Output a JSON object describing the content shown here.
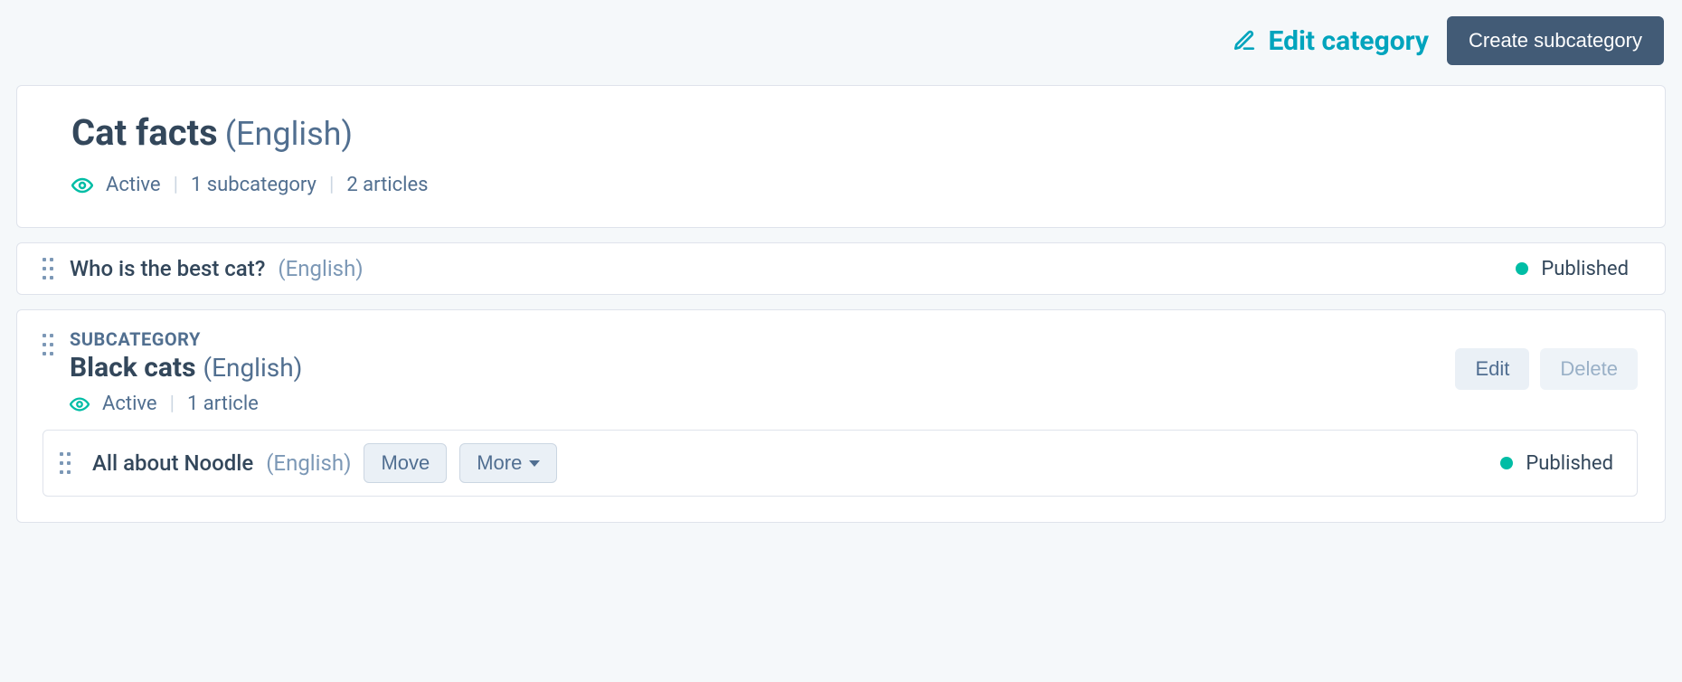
{
  "top_actions": {
    "edit_category": "Edit category",
    "create_subcategory": "Create subcategory"
  },
  "category": {
    "name": "Cat facts",
    "lang": "(English)",
    "active_label": "Active",
    "subcategory_count_label": "1 subcategory",
    "article_count_label": "2 articles"
  },
  "article1": {
    "title": "Who is the best cat?",
    "lang": "(English)",
    "status": "Published"
  },
  "subcategory": {
    "kicker": "SUBCATEGORY",
    "name": "Black cats",
    "lang": "(English)",
    "active_label": "Active",
    "article_count_label": "1 article",
    "actions": {
      "edit": "Edit",
      "delete": "Delete"
    }
  },
  "article2": {
    "title": "All about Noodle",
    "lang": "(English)",
    "status": "Published",
    "actions": {
      "move": "Move",
      "more": "More"
    }
  }
}
